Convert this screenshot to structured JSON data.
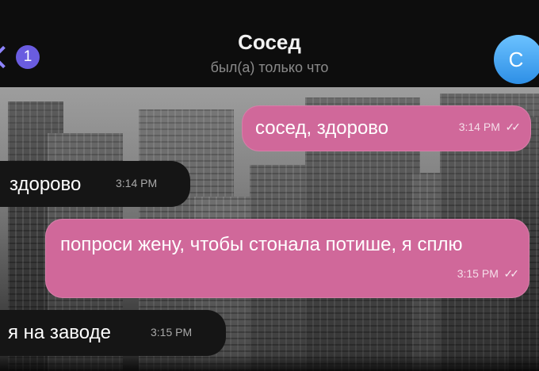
{
  "header": {
    "unread_count": "1",
    "contact_name": "Сосед",
    "status": "был(а) только что",
    "avatar_letter": "С"
  },
  "messages": [
    {
      "direction": "outgoing",
      "text": "сосед, здорово",
      "time": "3:14 PM",
      "read_ticks": "✓✓"
    },
    {
      "direction": "incoming",
      "text": "здорово",
      "time": "3:14 PM"
    },
    {
      "direction": "outgoing",
      "text": "попроси жену, чтобы стонала потише, я сплю",
      "time": "3:15 PM",
      "read_ticks": "✓✓"
    },
    {
      "direction": "incoming",
      "text": "я на заводе",
      "time": "3:15 PM"
    }
  ],
  "colors": {
    "outgoing_bubble": "#d0689a",
    "incoming_bubble": "#151515",
    "accent": "#6a5ce0",
    "avatar": "#2e8fe6"
  }
}
